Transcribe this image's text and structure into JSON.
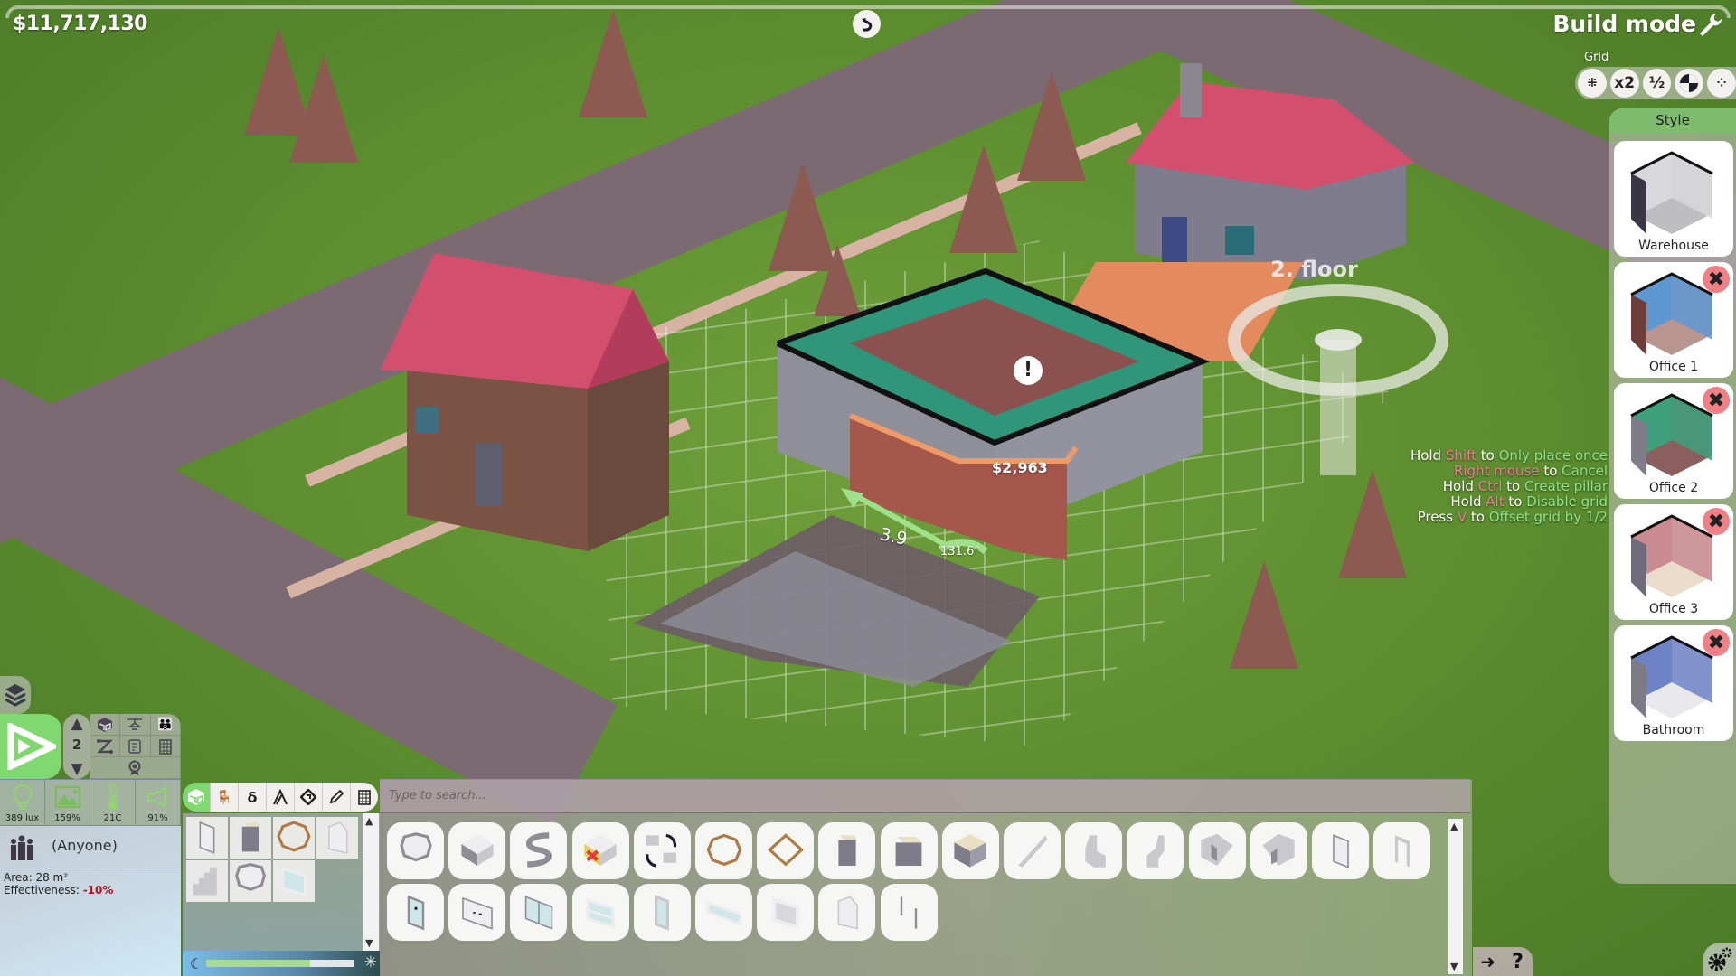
{
  "hud": {
    "money": "$11,717,130",
    "mode_title": "Build mode",
    "grid_label": "Grid",
    "grid_buttons": [
      {
        "name": "grid-snap",
        "icon": "grid-snap-icon",
        "label": ""
      },
      {
        "name": "grid-double",
        "icon": "",
        "label": "x2"
      },
      {
        "name": "grid-half",
        "icon": "",
        "label": "½"
      },
      {
        "name": "grid-quarter-rotate",
        "icon": "quarter-circle-icon",
        "label": ""
      },
      {
        "name": "grid-free",
        "icon": "grid-free-icon",
        "label": ""
      }
    ]
  },
  "style_panel": {
    "title": "Style",
    "styles": [
      {
        "label": "Warehouse",
        "wall": "#d9d9dc",
        "floor": "#bdbdc2",
        "side": "#3a3644",
        "deletable": false
      },
      {
        "label": "Office 1",
        "wall": "#5e98d3",
        "floor": "#b8968f",
        "side": "#6d3d3a",
        "deletable": true
      },
      {
        "label": "Office 2",
        "wall": "#3ea07c",
        "floor": "#8b5f5d",
        "side": "#807d88",
        "deletable": true
      },
      {
        "label": "Office 3",
        "wall": "#c98b90",
        "floor": "#eadcc8",
        "side": "#6f6b78",
        "deletable": true
      },
      {
        "label": "Bathroom",
        "wall": "#6e82c8",
        "floor": "#e9e9ec",
        "side": "#7c7b86",
        "deletable": true
      }
    ],
    "delete_symbol": "✖"
  },
  "hints": [
    [
      {
        "t": "Hold ",
        "c": "w"
      },
      {
        "t": "Shift",
        "c": "k"
      },
      {
        "t": " to ",
        "c": "w"
      },
      {
        "t": "Only place once",
        "c": "a"
      }
    ],
    [
      {
        "t": "Right mouse",
        "c": "k"
      },
      {
        "t": " to ",
        "c": "w"
      },
      {
        "t": "Cancel",
        "c": "a"
      }
    ],
    [
      {
        "t": "Hold ",
        "c": "w"
      },
      {
        "t": "Ctrl",
        "c": "k"
      },
      {
        "t": " to ",
        "c": "w"
      },
      {
        "t": "Create pillar",
        "c": "a"
      }
    ],
    [
      {
        "t": "Hold ",
        "c": "w"
      },
      {
        "t": "Alt",
        "c": "k"
      },
      {
        "t": " to ",
        "c": "w"
      },
      {
        "t": "Disable grid",
        "c": "a"
      }
    ],
    [
      {
        "t": "Press ",
        "c": "w"
      },
      {
        "t": "V",
        "c": "k"
      },
      {
        "t": " to ",
        "c": "w"
      },
      {
        "t": "Offset grid by 1/2",
        "c": "a"
      }
    ]
  ],
  "scene": {
    "floor_label": "2. floor",
    "placement_cost": "$2,963",
    "wall_length": "3.9",
    "wall_angle": "131.6°",
    "warning_symbol": "!"
  },
  "left_panel": {
    "floor_number": "2",
    "stats": [
      {
        "name": "light",
        "icon": "lightbulb-icon",
        "value": "389 lux"
      },
      {
        "name": "environment",
        "icon": "picture-icon",
        "value": "159%"
      },
      {
        "name": "temperature",
        "icon": "thermometer-icon",
        "value": "21C"
      },
      {
        "name": "noise",
        "icon": "speaker-icon",
        "value": "91%"
      }
    ],
    "room_owner": "(Anyone)",
    "area": "Area: 28 m²",
    "effectiveness_label": "Effectiveness: ",
    "effectiveness_value": "-10%"
  },
  "daylight": {
    "value_fraction": 0.7
  },
  "catalog": {
    "search_placeholder": "Type to search...",
    "categories": [
      "rooms",
      "furniture",
      "decoration",
      "roofs",
      "paths",
      "tools",
      "buildings"
    ],
    "active_category": 0,
    "recent_items": [
      "door",
      "elevator",
      "octagon-fence",
      "arched-door",
      "stairs",
      "octagon-room",
      "window"
    ],
    "items_row1": [
      "octagon-room",
      "square-room",
      "curved-wall",
      "delete-room",
      "swap-room",
      "octagon-fence",
      "square-fence",
      "elevator",
      "large-elevator",
      "glass-elevator",
      "straight-stairs",
      "switchback-stairs",
      "l-stairs",
      "u-stairs-left",
      "u-stairs-right",
      "door",
      "door-frame"
    ],
    "items_row2": [
      "bathroom-door",
      "double-door-sign",
      "double-glass-door",
      "window-double",
      "tall-window",
      "wide-window",
      "square-window",
      "arched-door",
      "wall-gap"
    ]
  }
}
